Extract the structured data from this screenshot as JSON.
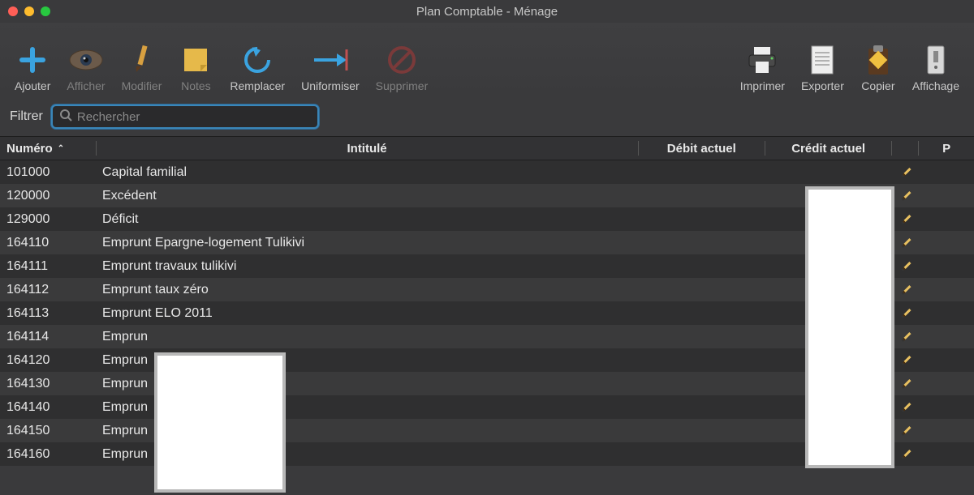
{
  "window": {
    "title": "Plan Comptable - Ménage"
  },
  "toolbar": {
    "ajouter": "Ajouter",
    "afficher": "Afficher",
    "modifier": "Modifier",
    "notes": "Notes",
    "remplacer": "Remplacer",
    "uniformiser": "Uniformiser",
    "supprimer": "Supprimer",
    "imprimer": "Imprimer",
    "exporter": "Exporter",
    "copier": "Copier",
    "affichage": "Affichage"
  },
  "filter": {
    "label": "Filtrer",
    "placeholder": "Rechercher"
  },
  "columns": {
    "numero": "Numéro",
    "intitule": "Intitulé",
    "debit": "Débit actuel",
    "credit": "Crédit actuel",
    "p": "P"
  },
  "rows": [
    {
      "num": "101000",
      "name": "Capital familial"
    },
    {
      "num": "120000",
      "name": "Excédent"
    },
    {
      "num": "129000",
      "name": "Déficit"
    },
    {
      "num": "164110",
      "name": "Emprunt Epargne-logement Tulikivi"
    },
    {
      "num": "164111",
      "name": "Emprunt travaux tulikivi"
    },
    {
      "num": "164112",
      "name": "Emprunt taux zéro"
    },
    {
      "num": "164113",
      "name": "Emprunt ELO 2011"
    },
    {
      "num": "164114",
      "name": "Emprun"
    },
    {
      "num": "164120",
      "name": "Emprun"
    },
    {
      "num": "164130",
      "name": "Emprun"
    },
    {
      "num": "164140",
      "name": "Emprun"
    },
    {
      "num": "164150",
      "name": "Emprun"
    },
    {
      "num": "164160",
      "name": "Emprun"
    }
  ]
}
